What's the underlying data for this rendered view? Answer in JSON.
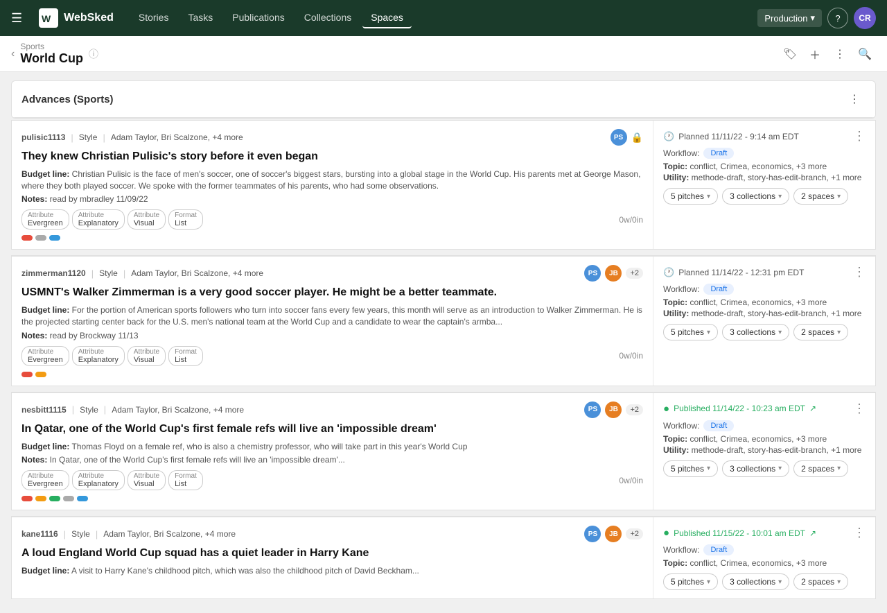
{
  "nav": {
    "logo_text": "WebSked",
    "links": [
      "Stories",
      "Tasks",
      "Publications",
      "Collections",
      "Spaces"
    ],
    "active_link": "Spaces",
    "env": "Production",
    "help_label": "?",
    "avatar_label": "CR"
  },
  "breadcrumb": {
    "parent": "Sports",
    "title": "World Cup"
  },
  "section": {
    "title": "Advances (Sports)"
  },
  "stories": [
    {
      "id": "pulisic1113",
      "section": "Style",
      "authors": "Adam Taylor, Bri Scalzone, +4 more",
      "avatars": [
        "PS"
      ],
      "has_lock": true,
      "headline": "They knew Christian Pulisic's story before it even began",
      "budget_label": "Budget line:",
      "budget": "Christian Pulisic is the face of men's soccer, one of soccer's biggest stars, bursting into a global stage in the World Cup. His parents met at George Mason, where they both played soccer. We spoke with the former teammates of his parents, who had some observations.",
      "notes_label": "Notes:",
      "notes": "read by mbradley 11/09/22",
      "tags": [
        {
          "label": "Attribute",
          "value": "Evergreen"
        },
        {
          "label": "Attribute",
          "value": "Explanatory"
        },
        {
          "label": "Attribute",
          "value": "Visual"
        },
        {
          "label": "Format",
          "value": "List"
        }
      ],
      "word_count": "0w/0in",
      "dots": [
        "#e74c3c",
        "#aaa",
        "#3498db"
      ],
      "schedule_type": "planned",
      "schedule_icon": "🕐",
      "schedule_text": "Planned 11/11/22 - 9:14 am EDT",
      "workflow": "Draft",
      "topic": "conflict, Crimea, economics, +3 more",
      "utility": "methode-draft, story-has-edit-branch, +1 more",
      "pitches": "5 pitches",
      "collections": "3 collections",
      "spaces": "2 spaces"
    },
    {
      "id": "zimmerman1120",
      "section": "Style",
      "authors": "Adam Taylor, Bri Scalzone, +4 more",
      "avatars": [
        "PS",
        "JB"
      ],
      "extra_count": "+2",
      "has_lock": false,
      "headline": "USMNT's Walker Zimmerman is a very good soccer player. He might be a better teammate.",
      "budget_label": "Budget line:",
      "budget": "For the portion of American sports followers who turn into soccer fans every few years, this month will serve as an introduction to Walker Zimmerman. He is the projected starting center back for the U.S. men's national team at the World Cup and a candidate to wear the captain's armba...",
      "notes_label": "Notes:",
      "notes": "read by Brockway 11/13",
      "tags": [
        {
          "label": "Attribute",
          "value": "Evergreen"
        },
        {
          "label": "Attribute",
          "value": "Explanatory"
        },
        {
          "label": "Attribute",
          "value": "Visual"
        },
        {
          "label": "Format",
          "value": "List"
        }
      ],
      "word_count": "0w/0in",
      "dots": [
        "#e74c3c",
        "#f39c12"
      ],
      "schedule_type": "planned",
      "schedule_icon": "🕐",
      "schedule_text": "Planned 11/14/22 - 12:31 pm EDT",
      "workflow": "Draft",
      "topic": "conflict, Crimea, economics, +3 more",
      "utility": "methode-draft, story-has-edit-branch, +1 more",
      "pitches": "5 pitches",
      "collections": "3 collections",
      "spaces": "2 spaces"
    },
    {
      "id": "nesbitt1115",
      "section": "Style",
      "authors": "Adam Taylor, Bri Scalzone, +4 more",
      "avatars": [
        "PS",
        "JB"
      ],
      "extra_count": "+2",
      "has_lock": false,
      "headline": "In Qatar, one of the World Cup's first female refs will live an 'impossible dream'",
      "budget_label": "Budget line:",
      "budget": "Thomas Floyd on a female ref, who is also a chemistry professor, who will take part in this year's World Cup",
      "notes_label": "Notes:",
      "notes": "In Qatar, one of the World Cup's first female refs will live an 'impossible dream'...",
      "tags": [
        {
          "label": "Attribute",
          "value": "Evergreen"
        },
        {
          "label": "Attribute",
          "value": "Explanatory"
        },
        {
          "label": "Attribute",
          "value": "Visual"
        },
        {
          "label": "Format",
          "value": "List"
        }
      ],
      "word_count": "0w/0in",
      "dots": [
        "#e74c3c",
        "#f39c12",
        "#27ae60",
        "#aaa",
        "#3498db"
      ],
      "schedule_type": "published",
      "schedule_icon": "✓",
      "schedule_text": "Published 11/14/22 - 10:23 am EDT",
      "workflow": "Draft",
      "topic": "conflict, Crimea, economics, +3 more",
      "utility": "methode-draft, story-has-edit-branch, +1 more",
      "pitches": "5 pitches",
      "collections": "3 collections",
      "spaces": "2 spaces"
    },
    {
      "id": "kane1116",
      "section": "Style",
      "authors": "Adam Taylor, Bri Scalzone, +4 more",
      "avatars": [
        "PS",
        "JB"
      ],
      "extra_count": "+2",
      "has_lock": false,
      "headline": "A loud England World Cup squad has a quiet leader in Harry Kane",
      "budget_label": "Budget line:",
      "budget": "A visit to Harry Kane's childhood pitch, which was also the childhood pitch of David Beckham...",
      "notes_label": "Notes:",
      "notes": "",
      "tags": [],
      "word_count": "",
      "dots": [],
      "schedule_type": "published",
      "schedule_icon": "✓",
      "schedule_text": "Published 11/15/22 - 10:01 am EDT",
      "workflow": "Draft",
      "topic": "conflict, Crimea, economics, +3 more",
      "utility": "",
      "pitches": "5 pitches",
      "collections": "3 collections",
      "spaces": "2 spaces"
    }
  ],
  "labels": {
    "topic": "Topic:",
    "utility": "Utility:",
    "workflow": "Workflow:"
  }
}
